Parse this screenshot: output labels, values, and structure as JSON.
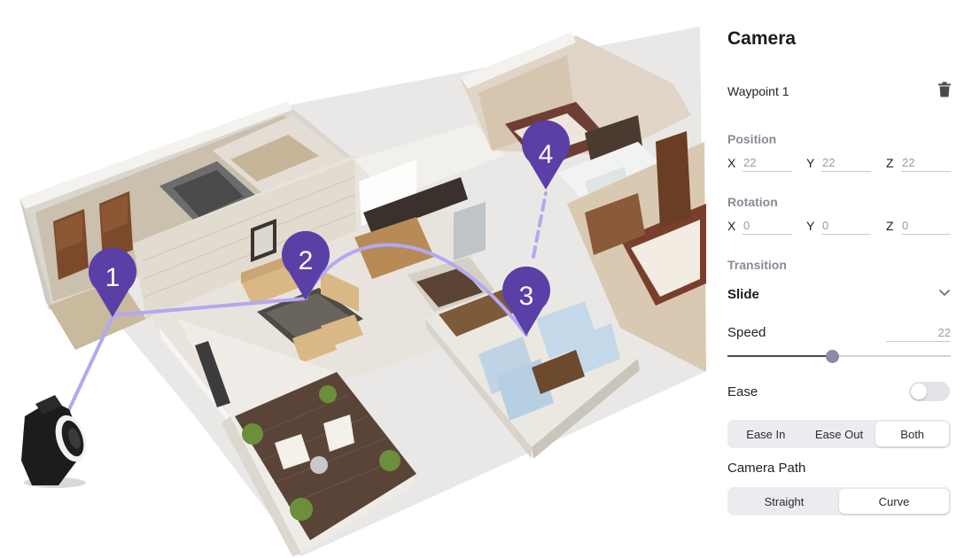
{
  "camera_panel": {
    "title": "Camera",
    "waypoint_label": "Waypoint 1",
    "position": {
      "label": "Position",
      "x_label": "X",
      "y_label": "Y",
      "z_label": "Z",
      "x": "22",
      "y": "22",
      "z": "22"
    },
    "rotation": {
      "label": "Rotation",
      "x_label": "X",
      "y_label": "Y",
      "z_label": "Z",
      "x": "0",
      "y": "0",
      "z": "0"
    },
    "transition": {
      "label": "Transition",
      "selected": "Slide"
    },
    "speed": {
      "label": "Speed",
      "value": "22",
      "slider_fraction": 0.47
    },
    "ease": {
      "label": "Ease",
      "enabled": false,
      "options": [
        "Ease In",
        "Ease Out",
        "Both"
      ],
      "selected": "Both"
    },
    "camera_path": {
      "label": "Camera Path",
      "options": [
        "Straight",
        "Curve"
      ],
      "selected": "Curve"
    }
  },
  "scene": {
    "waypoints": [
      "1",
      "2",
      "3",
      "4"
    ],
    "path_color": "#b4a8f0",
    "marker_color": "#5a3fa6"
  }
}
